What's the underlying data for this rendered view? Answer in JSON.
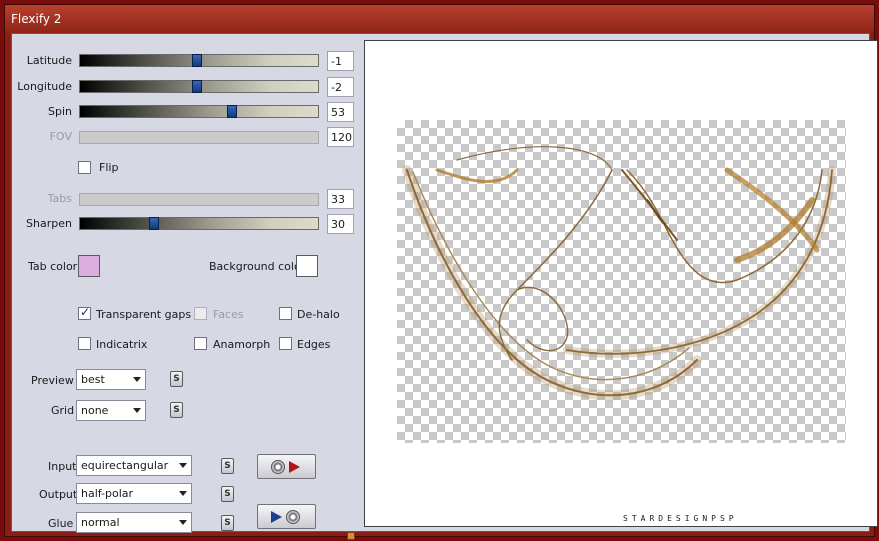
{
  "window": {
    "title": "Flexify 2"
  },
  "params": {
    "latitude": {
      "label": "Latitude",
      "value": "-1",
      "fill": 0.49
    },
    "longitude": {
      "label": "Longitude",
      "value": "-2",
      "fill": 0.49
    },
    "spin": {
      "label": "Spin",
      "value": "53",
      "fill": 0.64
    },
    "fov": {
      "label": "FOV",
      "value": "120"
    },
    "tabs": {
      "label": "Tabs",
      "value": "33"
    },
    "sharpen": {
      "label": "Sharpen",
      "value": "30",
      "fill": 0.3
    }
  },
  "flip": {
    "label": "Flip",
    "checked": false
  },
  "colors": {
    "tab_label": "Tab color",
    "tab_value": "#dcaede",
    "bg_label": "Background color",
    "bg_value": "#ffffff"
  },
  "options": {
    "transparent_gaps": {
      "label": "Transparent gaps",
      "checked": true
    },
    "faces": {
      "label": "Faces",
      "checked": false
    },
    "de_halo": {
      "label": "De-halo",
      "checked": false
    },
    "indicatrix": {
      "label": "Indicatrix",
      "checked": false
    },
    "anamorph": {
      "label": "Anamorph",
      "checked": false
    },
    "edges": {
      "label": "Edges",
      "checked": false
    }
  },
  "preview": {
    "label": "Preview",
    "value": "best"
  },
  "grid": {
    "label": "Grid",
    "value": "none"
  },
  "input": {
    "label": "Input",
    "value": "equirectangular"
  },
  "output": {
    "label": "Output",
    "value": "half-polar"
  },
  "glue": {
    "label": "Glue",
    "value": "normal"
  },
  "s_button_text": "S",
  "watermark": "STARDESIGNPSP"
}
